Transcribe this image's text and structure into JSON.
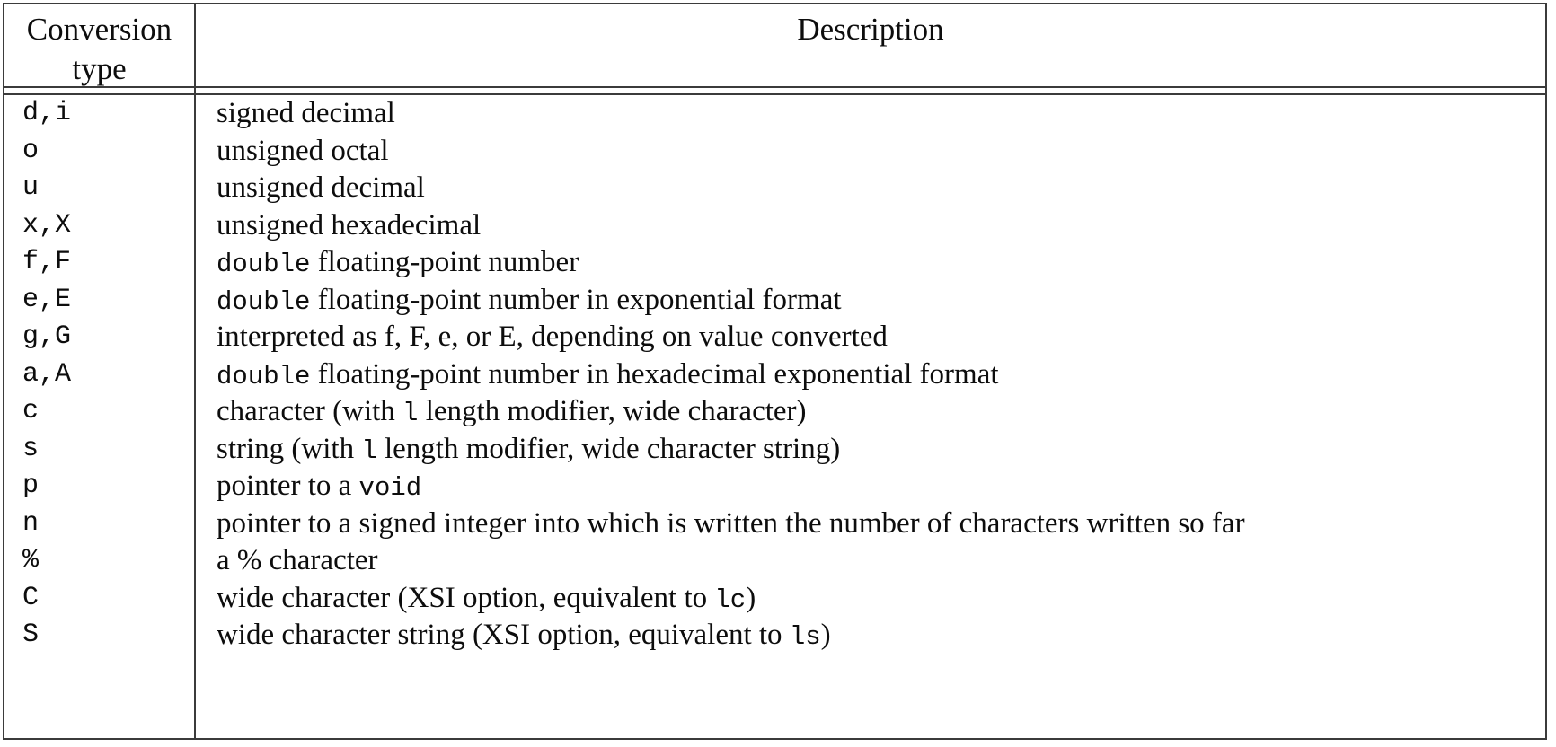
{
  "table": {
    "headers": {
      "col1_line1": "Conversion",
      "col1_line2": "type",
      "col2": "Description"
    },
    "rows": [
      {
        "type": "d,i",
        "desc_parts": [
          {
            "text": "signed decimal",
            "mono": false
          }
        ]
      },
      {
        "type": "o",
        "desc_parts": [
          {
            "text": "unsigned octal",
            "mono": false
          }
        ]
      },
      {
        "type": "u",
        "desc_parts": [
          {
            "text": "unsigned decimal",
            "mono": false
          }
        ]
      },
      {
        "type": "x,X",
        "desc_parts": [
          {
            "text": "unsigned hexadecimal",
            "mono": false
          }
        ]
      },
      {
        "type": "f,F",
        "desc_parts": [
          {
            "text": "double",
            "mono": true
          },
          {
            "text": " floating-point number",
            "mono": false
          }
        ]
      },
      {
        "type": "e,E",
        "desc_parts": [
          {
            "text": "double",
            "mono": true
          },
          {
            "text": " floating-point number in exponential format",
            "mono": false
          }
        ]
      },
      {
        "type": "g,G",
        "desc_parts": [
          {
            "text": "interpreted as f, F, e, or E, depending on value converted",
            "mono": false
          }
        ]
      },
      {
        "type": "a,A",
        "desc_parts": [
          {
            "text": "double",
            "mono": true
          },
          {
            "text": " floating-point number in hexadecimal exponential format",
            "mono": false
          }
        ]
      },
      {
        "type": "c",
        "desc_parts": [
          {
            "text": "character (with ",
            "mono": false
          },
          {
            "text": "l",
            "mono": true
          },
          {
            "text": " length modifier, wide character)",
            "mono": false
          }
        ]
      },
      {
        "type": "s",
        "desc_parts": [
          {
            "text": "string (with ",
            "mono": false
          },
          {
            "text": "l",
            "mono": true
          },
          {
            "text": " length modifier, wide character string)",
            "mono": false
          }
        ]
      },
      {
        "type": "p",
        "desc_parts": [
          {
            "text": "pointer to a ",
            "mono": false
          },
          {
            "text": "void",
            "mono": true
          }
        ]
      },
      {
        "type": "n",
        "desc_parts": [
          {
            "text": "pointer to a signed integer into which is written the number of characters written so far",
            "mono": false
          }
        ]
      },
      {
        "type": "%",
        "desc_parts": [
          {
            "text": "a % character",
            "mono": false
          }
        ]
      },
      {
        "type": "C",
        "desc_parts": [
          {
            "text": "wide character (XSI option, equivalent to ",
            "mono": false
          },
          {
            "text": "lc",
            "mono": true
          },
          {
            "text": ")",
            "mono": false
          }
        ]
      },
      {
        "type": "S",
        "desc_parts": [
          {
            "text": "wide character string (XSI option, equivalent to ",
            "mono": false
          },
          {
            "text": "ls",
            "mono": true
          },
          {
            "text": ")",
            "mono": false
          }
        ]
      }
    ]
  }
}
